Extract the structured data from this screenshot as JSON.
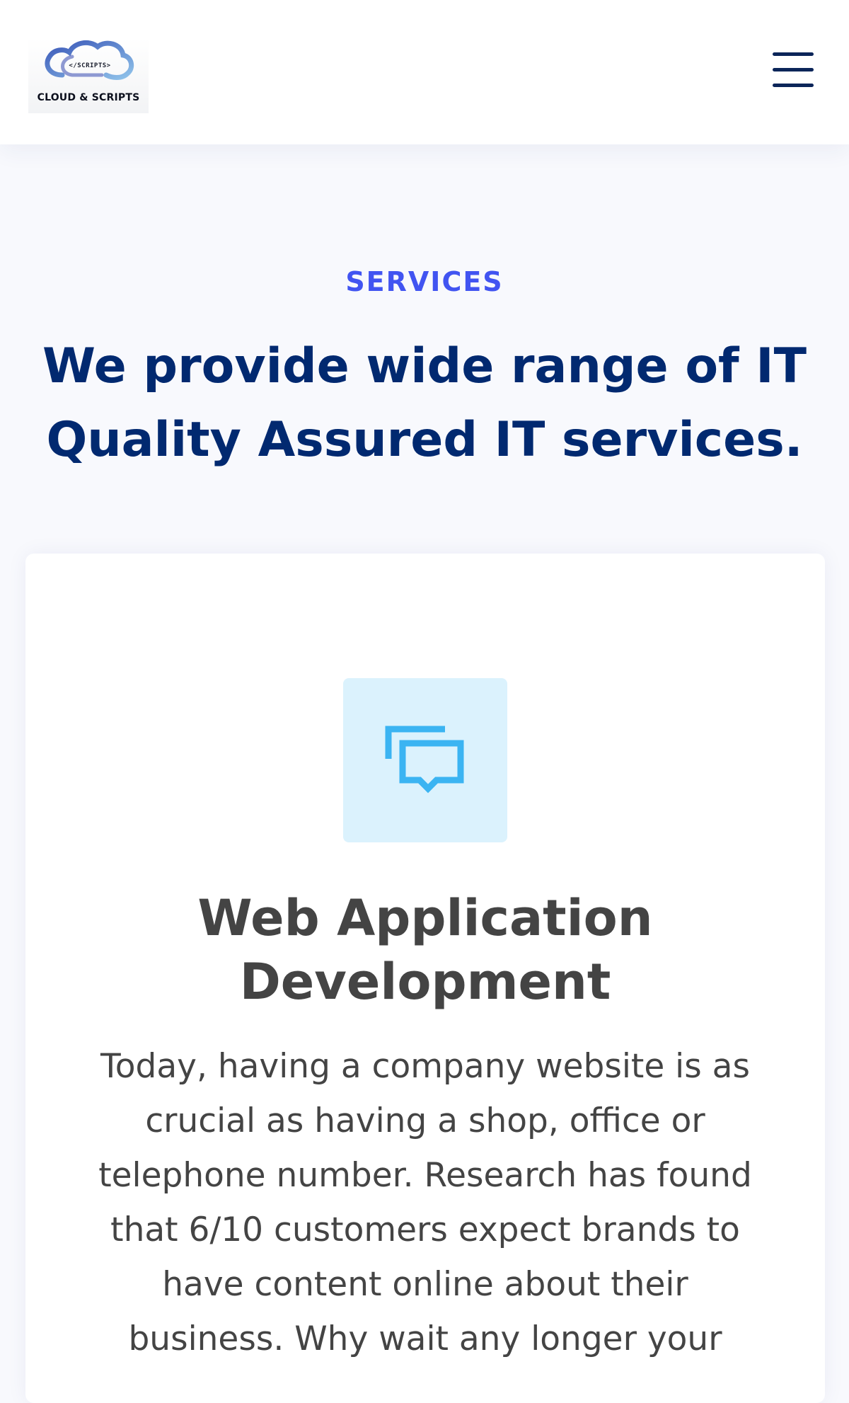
{
  "header": {
    "logo": {
      "tagline": "</SCRIPTS>",
      "name": "CLOUD & SCRIPTS",
      "icon": "cloud-logo-icon"
    },
    "menu_icon": "hamburger-menu-icon"
  },
  "services": {
    "eyebrow": "SERVICES",
    "title": "We provide wide range of IT Quality Assured IT services.",
    "cards": [
      {
        "icon": "chat-bubbles-icon",
        "title": "Web Application Development",
        "text": "Today, having a company website is as crucial as having a shop, office or telephone number. Research has found that 6/10 customers expect brands to have content online about their business. Why wait any longer your"
      }
    ]
  },
  "colors": {
    "accent": "#4154f1",
    "heading": "#012970",
    "icon_bg": "#dbf2fd",
    "icon_stroke": "#3bb4f2",
    "text": "#444444"
  }
}
